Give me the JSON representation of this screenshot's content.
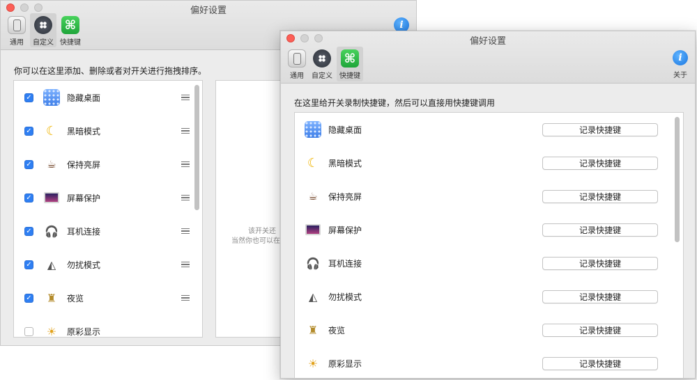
{
  "back_window": {
    "title": "偏好设置",
    "toolbar": [
      {
        "label": "通用",
        "icon": "general-icon"
      },
      {
        "label": "自定义",
        "icon": "customize-icon",
        "selected": true
      },
      {
        "label": "快捷键",
        "icon": "shortcut-icon"
      }
    ],
    "instruction": "你可以在这里添加、删除或者对开关进行拖拽排序。",
    "items": [
      {
        "label": "隐藏桌面",
        "checked": true,
        "icon": "hide-desktop-icon"
      },
      {
        "label": "黑暗模式",
        "checked": true,
        "icon": "dark-mode-icon"
      },
      {
        "label": "保持亮屏",
        "checked": true,
        "icon": "keep-awake-icon"
      },
      {
        "label": "屏幕保护",
        "checked": true,
        "icon": "screensaver-icon"
      },
      {
        "label": "耳机连接",
        "checked": true,
        "icon": "headphones-icon"
      },
      {
        "label": "勿扰模式",
        "checked": true,
        "icon": "do-not-disturb-icon"
      },
      {
        "label": "夜览",
        "checked": true,
        "icon": "night-shift-icon"
      },
      {
        "label": "原彩显示",
        "checked": false,
        "icon": "true-tone-icon"
      }
    ],
    "side_panel_text": [
      "该开关还",
      "当然你也可以在"
    ]
  },
  "front_window": {
    "title": "偏好设置",
    "toolbar": [
      {
        "label": "通用",
        "icon": "general-icon"
      },
      {
        "label": "自定义",
        "icon": "customize-icon"
      },
      {
        "label": "快捷键",
        "icon": "shortcut-icon",
        "selected": true
      }
    ],
    "about_label": "关于",
    "instruction": "在这里给开关录制快捷键，然后可以直接用快捷键调用",
    "record_label": "记录快捷键",
    "items": [
      {
        "label": "隐藏桌面",
        "icon": "hide-desktop-icon"
      },
      {
        "label": "黑暗模式",
        "icon": "dark-mode-icon"
      },
      {
        "label": "保持亮屏",
        "icon": "keep-awake-icon"
      },
      {
        "label": "屏幕保护",
        "icon": "screensaver-icon"
      },
      {
        "label": "耳机连接",
        "icon": "headphones-icon"
      },
      {
        "label": "勿扰模式",
        "icon": "do-not-disturb-icon"
      },
      {
        "label": "夜览",
        "icon": "night-shift-icon"
      },
      {
        "label": "原彩显示",
        "icon": "true-tone-icon"
      }
    ]
  },
  "colors": {
    "checkbox_on": "#2f7ff2",
    "close_button": "#fc5f57",
    "shortcut_icon": "#1fa53a",
    "info_icon": "#1a76e0"
  }
}
